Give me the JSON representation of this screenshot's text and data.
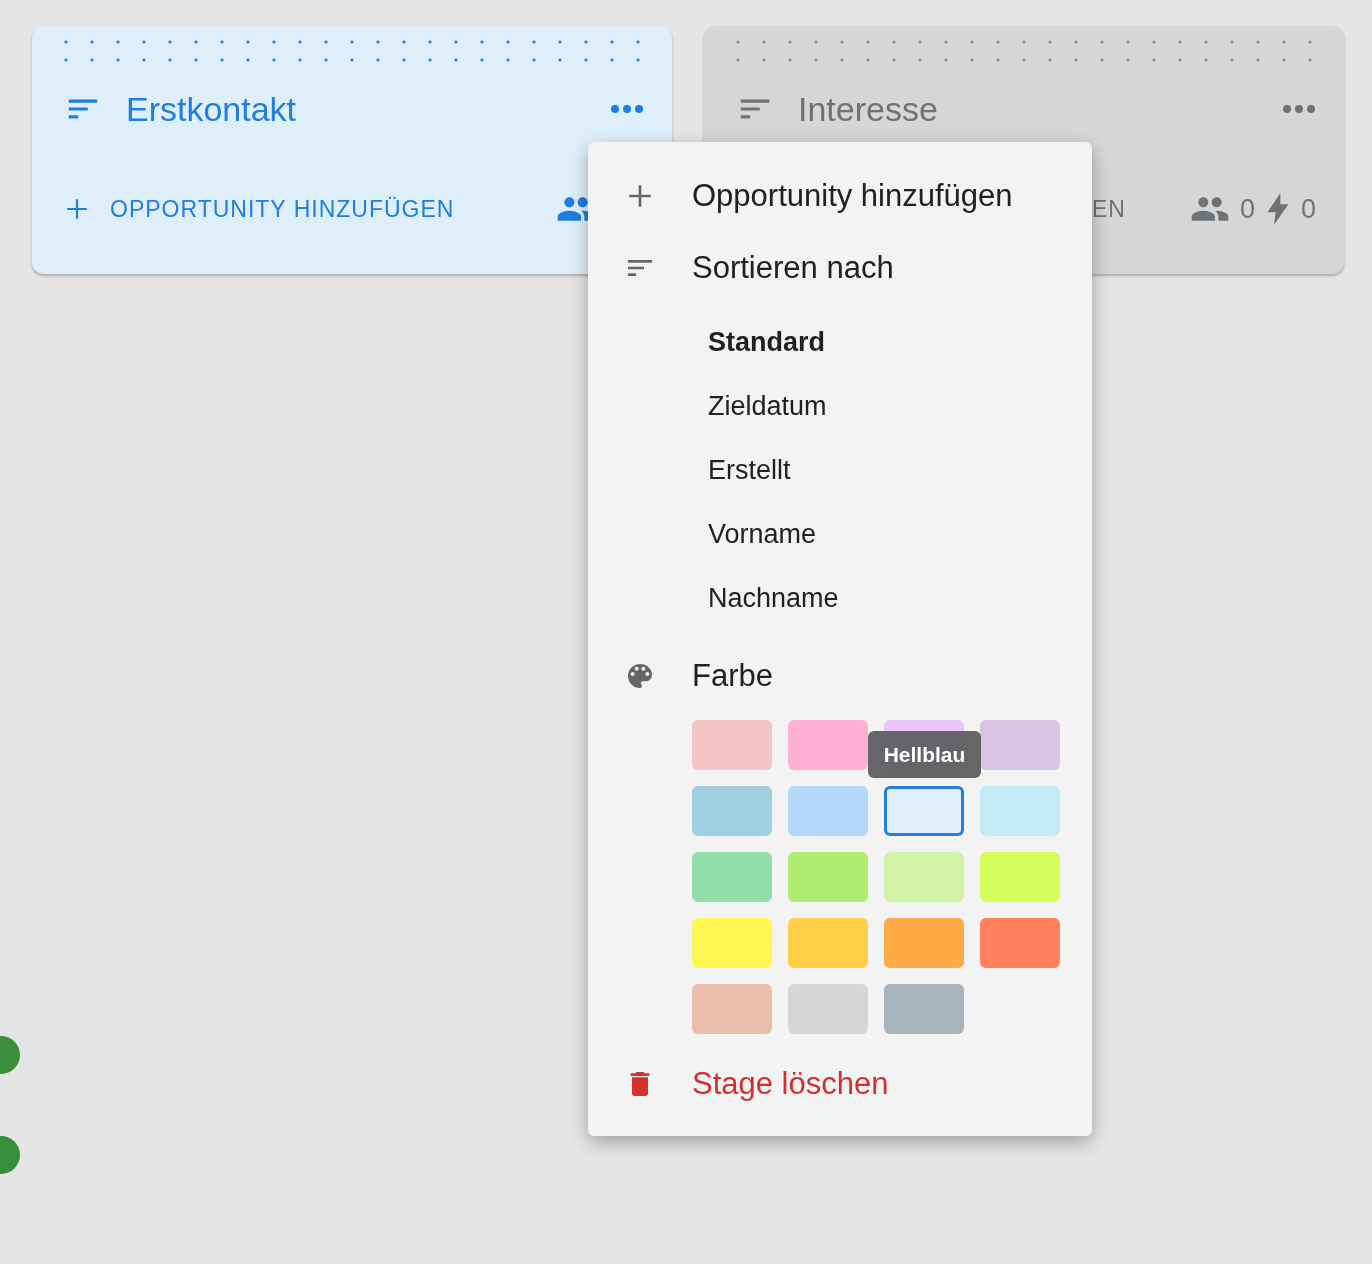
{
  "stages": [
    {
      "title": "Erstkontakt",
      "active": true,
      "color": "#deeffb",
      "add_label": "OPPORTUNITY HINZUFÜGEN"
    },
    {
      "title": "Interesse",
      "active": false,
      "color": "#d6d6d6",
      "add_label": "EN",
      "stats": [
        "0",
        "0"
      ]
    }
  ],
  "side_badges": [
    {
      "color": "#388e3c"
    },
    {
      "color": "#388e3c"
    }
  ],
  "menu": {
    "add_label": "Opportunity hinzufügen",
    "sort_label": "Sortieren nach",
    "sort_options": [
      {
        "label": "Standard",
        "selected": true
      },
      {
        "label": "Zieldatum",
        "selected": false
      },
      {
        "label": "Erstellt",
        "selected": false
      },
      {
        "label": "Vorname",
        "selected": false
      },
      {
        "label": "Nachname",
        "selected": false
      }
    ],
    "color_label": "Farbe",
    "swatches": [
      {
        "color": "#f4c4c7",
        "selected": false
      },
      {
        "color": "#ffb1d4",
        "selected": false
      },
      {
        "color": "#e8c5fb",
        "selected": false
      },
      {
        "color": "#dac4e6",
        "selected": false
      },
      {
        "color": "#a0cfe0",
        "selected": false
      },
      {
        "color": "#b2d9f9",
        "selected": false
      },
      {
        "color": "#deeffb",
        "selected": true
      },
      {
        "color": "#c3ecf6",
        "selected": false
      },
      {
        "color": "#92dfac",
        "selected": false
      },
      {
        "color": "#b0ec72",
        "selected": false
      },
      {
        "color": "#d1f4a8",
        "selected": false
      },
      {
        "color": "#d6ff5e",
        "selected": false
      },
      {
        "color": "#fff652",
        "selected": false
      },
      {
        "color": "#ffcf47",
        "selected": false
      },
      {
        "color": "#ffab45",
        "selected": false
      },
      {
        "color": "#ff805b",
        "selected": false
      },
      {
        "color": "#eabeac",
        "selected": false
      },
      {
        "color": "#d6d6d6",
        "selected": false
      },
      {
        "color": "#a7b4bb",
        "selected": false
      }
    ],
    "tooltip": "Hellblau",
    "delete_label": "Stage löschen"
  }
}
